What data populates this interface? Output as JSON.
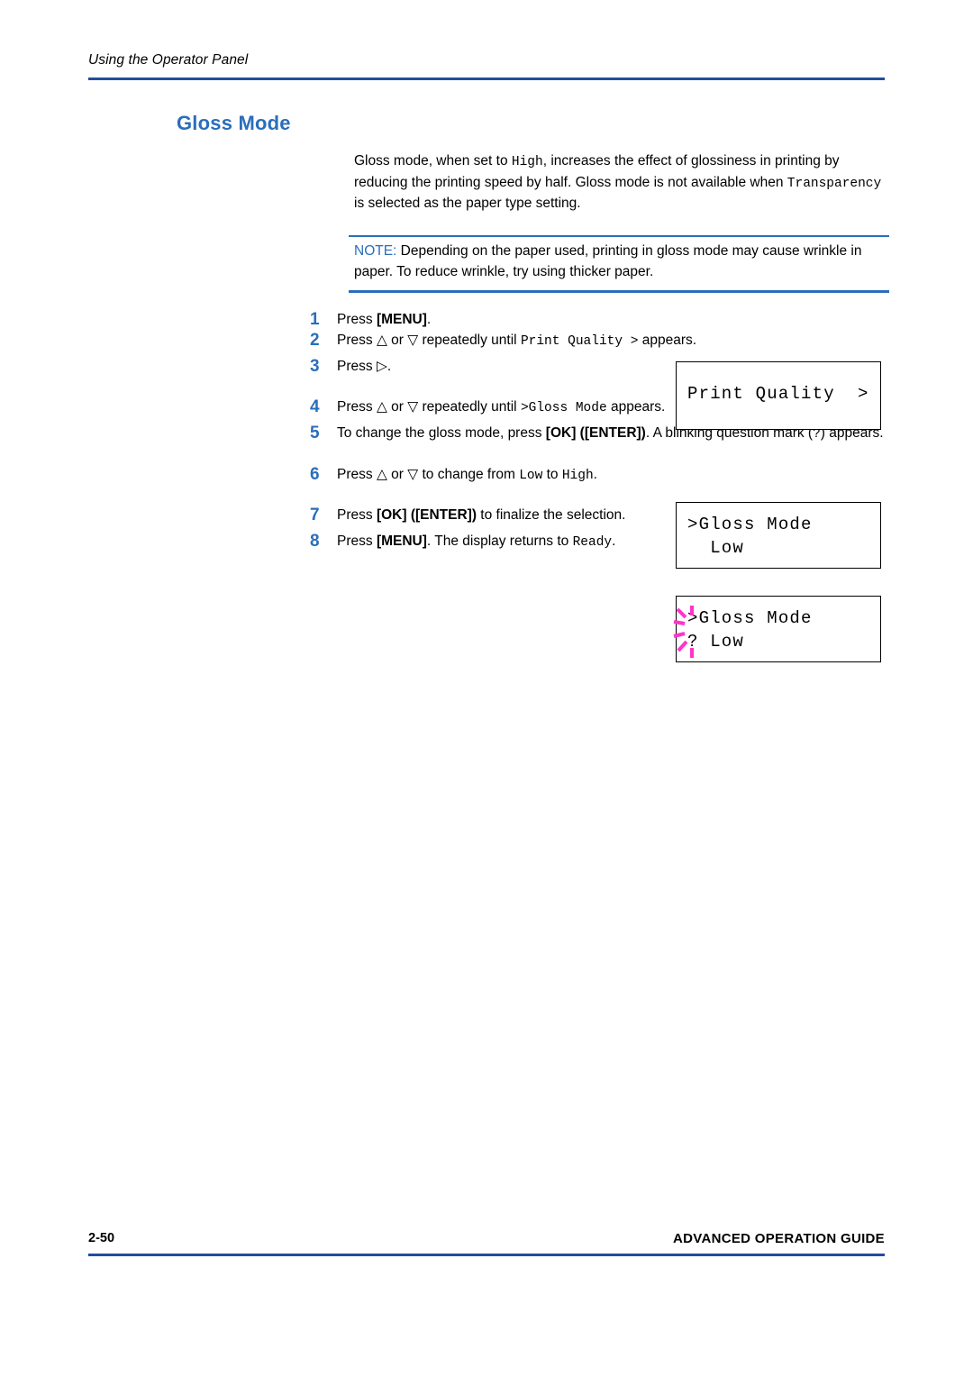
{
  "header": {
    "title": "Using the Operator Panel"
  },
  "section": {
    "heading": "Gloss Mode"
  },
  "intro": {
    "part1": "Gloss mode, when set to ",
    "code1": "High",
    "part2": ", increases the effect of glossiness in printing by reducing the printing speed by half. Gloss mode is not available when ",
    "code2": "Transparency",
    "part3": " is selected as the paper type setting."
  },
  "note": {
    "label": "NOTE:",
    "text": " Depending on the paper used, printing in gloss mode may cause wrinkle in paper. To reduce wrinkle, try using thicker paper."
  },
  "steps": [
    {
      "num": "1",
      "parts": [
        {
          "t": "Press ",
          "s": "plain"
        },
        {
          "t": "[MENU]",
          "s": "bold"
        },
        {
          "t": ".",
          "s": "plain"
        }
      ]
    },
    {
      "num": "2",
      "parts": [
        {
          "t": "Press ",
          "s": "plain"
        },
        {
          "t": "△",
          "s": "plain"
        },
        {
          "t": " or ",
          "s": "plain"
        },
        {
          "t": "▽",
          "s": "plain"
        },
        {
          "t": " repeatedly until ",
          "s": "plain"
        },
        {
          "t": "Print Quality >",
          "s": "mono"
        },
        {
          "t": " appears.",
          "s": "plain"
        }
      ]
    },
    {
      "num": "3",
      "parts": [
        {
          "t": "Press ",
          "s": "plain"
        },
        {
          "t": "▷",
          "s": "plain"
        },
        {
          "t": ".",
          "s": "plain"
        }
      ]
    },
    {
      "num": "4",
      "parts": [
        {
          "t": "Press ",
          "s": "plain"
        },
        {
          "t": "△",
          "s": "plain"
        },
        {
          "t": " or ",
          "s": "plain"
        },
        {
          "t": "▽",
          "s": "plain"
        },
        {
          "t": " repeatedly until ",
          "s": "plain"
        },
        {
          "t": ">Gloss Mode",
          "s": "mono"
        },
        {
          "t": " appears.",
          "s": "plain"
        }
      ]
    },
    {
      "num": "5",
      "parts": [
        {
          "t": "To change the gloss mode, press ",
          "s": "plain"
        },
        {
          "t": "[OK] ([ENTER])",
          "s": "bold"
        },
        {
          "t": ". A blinking question mark (",
          "s": "plain"
        },
        {
          "t": "?",
          "s": "mono"
        },
        {
          "t": ") appears.",
          "s": "plain"
        }
      ]
    },
    {
      "num": "6",
      "parts": [
        {
          "t": "Press ",
          "s": "plain"
        },
        {
          "t": "△",
          "s": "plain"
        },
        {
          "t": " or ",
          "s": "plain"
        },
        {
          "t": "▽",
          "s": "plain"
        },
        {
          "t": " to change from ",
          "s": "plain"
        },
        {
          "t": "Low",
          "s": "mono"
        },
        {
          "t": " to ",
          "s": "plain"
        },
        {
          "t": "High",
          "s": "mono"
        },
        {
          "t": ".",
          "s": "plain"
        }
      ]
    },
    {
      "num": "7",
      "parts": [
        {
          "t": "Press ",
          "s": "plain"
        },
        {
          "t": "[OK] ([ENTER])",
          "s": "bold"
        },
        {
          "t": " to finalize the selection.",
          "s": "plain"
        }
      ]
    },
    {
      "num": "8",
      "parts": [
        {
          "t": "Press ",
          "s": "plain"
        },
        {
          "t": "[MENU]",
          "s": "bold"
        },
        {
          "t": ". The display returns to ",
          "s": "plain"
        },
        {
          "t": "Ready",
          "s": "mono"
        },
        {
          "t": ".",
          "s": "plain"
        }
      ]
    }
  ],
  "lcd_panels": {
    "print_quality": {
      "line1": "Print Quality  >"
    },
    "gloss_mode": {
      "line1": ">Gloss Mode",
      "line2": "  Low"
    },
    "gloss_mode_blink": {
      "line1": ">Gloss Mode",
      "line2": "? Low"
    }
  },
  "footer": {
    "page_number": "2-50",
    "guide_title": "ADVANCED OPERATION GUIDE"
  },
  "colors": {
    "accent_blue": "#2a6ebb",
    "rule_blue": "#1f4e9c",
    "blink_magenta": "#ff33cc"
  }
}
